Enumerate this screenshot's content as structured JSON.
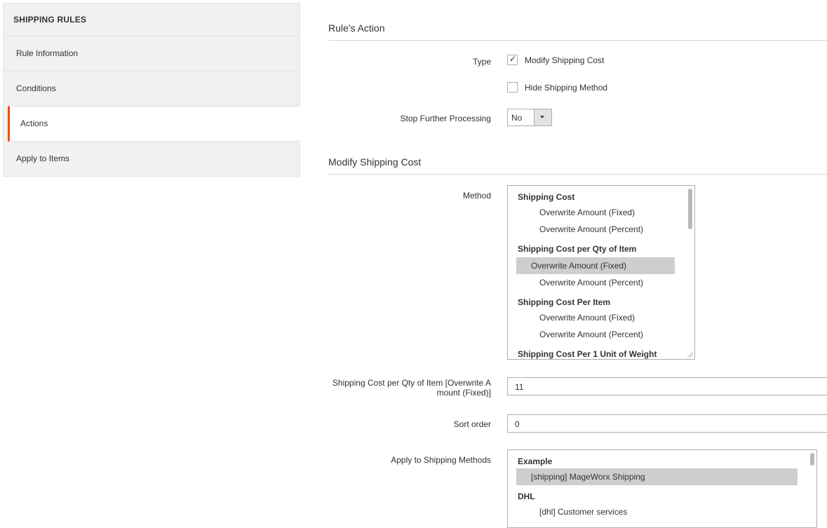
{
  "sidebar": {
    "title": "SHIPPING RULES",
    "items": [
      {
        "label": "Rule Information"
      },
      {
        "label": "Conditions"
      },
      {
        "label": "Actions"
      },
      {
        "label": "Apply to Items"
      }
    ]
  },
  "rules_action": {
    "title": "Rule's Action",
    "type_label": "Type",
    "type_options": [
      {
        "label": "Modify Shipping Cost",
        "checked": true
      },
      {
        "label": "Hide Shipping Method",
        "checked": false
      }
    ],
    "stop_label": "Stop Further Processing",
    "stop_value": "No"
  },
  "modify_cost": {
    "title": "Modify Shipping Cost",
    "method_label": "Method",
    "method_groups": [
      {
        "group": "Shipping Cost",
        "options": [
          "Overwrite Amount (Fixed)",
          "Overwrite Amount (Percent)"
        ]
      },
      {
        "group": "Shipping Cost per Qty of Item",
        "options": [
          "Overwrite Amount (Fixed)",
          "Overwrite Amount (Percent)"
        ]
      },
      {
        "group": "Shipping Cost Per Item",
        "options": [
          "Overwrite Amount (Fixed)",
          "Overwrite Amount (Percent)"
        ]
      },
      {
        "group": "Shipping Cost Per 1 Unit of Weight",
        "options": []
      }
    ],
    "qty_label_line1": "Shipping Cost per Qty of Item [Overwrite A",
    "qty_label_line2": "mount (Fixed)]",
    "qty_value": "11",
    "sort_label": "Sort order",
    "sort_value": "0",
    "methods_label": "Apply to Shipping Methods",
    "methods_groups": [
      {
        "group": "Example",
        "options": [
          "[shipping] MageWorx Shipping"
        ]
      },
      {
        "group": "DHL",
        "options": [
          "[dhl] Customer services"
        ]
      }
    ]
  }
}
